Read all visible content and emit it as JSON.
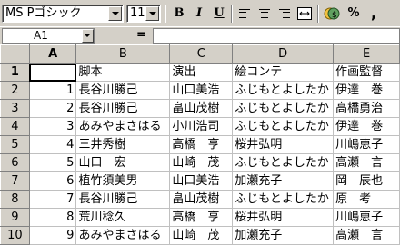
{
  "toolbar": {
    "font_name": "MS Pゴシック",
    "font_size": "11",
    "bold_label": "B",
    "italic_label": "I",
    "underline_label": "U",
    "percent_label": "%",
    "comma_label": ","
  },
  "formula_bar": {
    "name_box": "A1",
    "equals": "="
  },
  "columns": [
    "A",
    "B",
    "C",
    "D",
    "E"
  ],
  "rows": [
    {
      "num": "1",
      "a": "",
      "b": "脚本",
      "c": "演出",
      "d": "絵コンテ",
      "e": "作画監督"
    },
    {
      "num": "2",
      "a": "1",
      "b": "長谷川勝己",
      "c": "山口美浩",
      "d": "ふじもとよしたか",
      "e": "伊達　巻"
    },
    {
      "num": "3",
      "a": "2",
      "b": "長谷川勝己",
      "c": "畠山茂樹",
      "d": "ふじもとよしたか",
      "e": "高橋勇治"
    },
    {
      "num": "4",
      "a": "3",
      "b": "あみやまさはる",
      "c": "小川浩司",
      "d": "ふじもとよしたか",
      "e": "伊達　巻"
    },
    {
      "num": "5",
      "a": "4",
      "b": "三井秀樹",
      "c": "高橋　亨",
      "d": "桜井弘明",
      "e": "川嶋恵子"
    },
    {
      "num": "6",
      "a": "5",
      "b": "山口　宏",
      "c": "山崎　茂",
      "d": "ふじもとよしたか",
      "e": "高瀬　言"
    },
    {
      "num": "7",
      "a": "6",
      "b": "植竹須美男",
      "c": "山口美浩",
      "d": "加瀬充子",
      "e": "岡　辰也"
    },
    {
      "num": "8",
      "a": "7",
      "b": "長谷川勝己",
      "c": "畠山茂樹",
      "d": "ふじもとよしたか",
      "e": "原　考"
    },
    {
      "num": "9",
      "a": "8",
      "b": "荒川稔久",
      "c": "高橋　亨",
      "d": "桜井弘明",
      "e": "川嶋恵子"
    },
    {
      "num": "10",
      "a": "9",
      "b": "あみやまさはる",
      "c": "山崎　茂",
      "d": "加瀬充子",
      "e": "高瀬　言"
    }
  ]
}
